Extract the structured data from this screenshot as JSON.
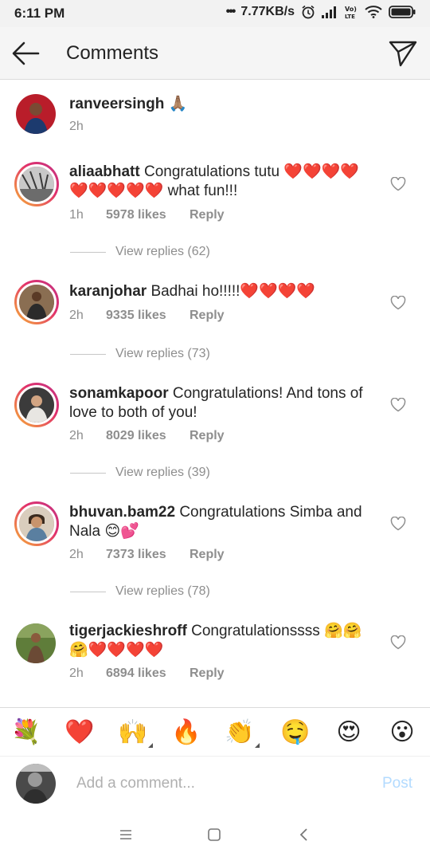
{
  "status_bar": {
    "time": "6:11 PM",
    "network_speed": "7.77KB/s",
    "icons": [
      "more-dots-icon",
      "alarm-icon",
      "signal-icon",
      "volte-icon",
      "wifi-icon",
      "battery-icon"
    ]
  },
  "header": {
    "title": "Comments",
    "back_icon": "back-arrow-icon",
    "share_icon": "send-icon"
  },
  "caption": {
    "username": "ranveersingh",
    "text": "🙏🏽",
    "time": "2h"
  },
  "comments": [
    {
      "username": "aliaabhatt",
      "text": "Congratulations tutu ❤️❤️❤️❤️❤️❤️❤️❤️❤️ what fun!!!",
      "time": "1h",
      "likes": "5978 likes",
      "reply": "Reply",
      "view_replies": "View replies (62)"
    },
    {
      "username": "karanjohar",
      "text": "Badhai ho!!!!!❤️❤️❤️❤️",
      "time": "2h",
      "likes": "9335 likes",
      "reply": "Reply",
      "view_replies": "View replies (73)"
    },
    {
      "username": "sonamkapoor",
      "text": "Congratulations! And tons of love to both of you!",
      "time": "2h",
      "likes": "8029 likes",
      "reply": "Reply",
      "view_replies": "View replies (39)"
    },
    {
      "username": "bhuvan.bam22",
      "text": "Congratulations Simba and Nala 😊💕",
      "time": "2h",
      "likes": "7373 likes",
      "reply": "Reply",
      "view_replies": "View replies (78)"
    },
    {
      "username": "tigerjackieshroff",
      "text": "Congratulationssss 🤗🤗🤗❤️❤️❤️❤️",
      "time": "2h",
      "likes": "6894 likes",
      "reply": "Reply"
    }
  ],
  "emoji_bar": [
    "💐",
    "❤️",
    "🙌",
    "🔥",
    "👏",
    "🤤",
    "😍",
    "😮"
  ],
  "composer": {
    "placeholder": "Add a comment...",
    "post_label": "Post"
  },
  "nav_bar": {
    "icons": [
      "menu-icon",
      "home-square-icon",
      "back-chevron-icon"
    ]
  },
  "colors": {
    "link_blue_disabled": "#b3dbff",
    "muted_text": "#8e8e8e",
    "heart_red": "#ed1b24"
  }
}
